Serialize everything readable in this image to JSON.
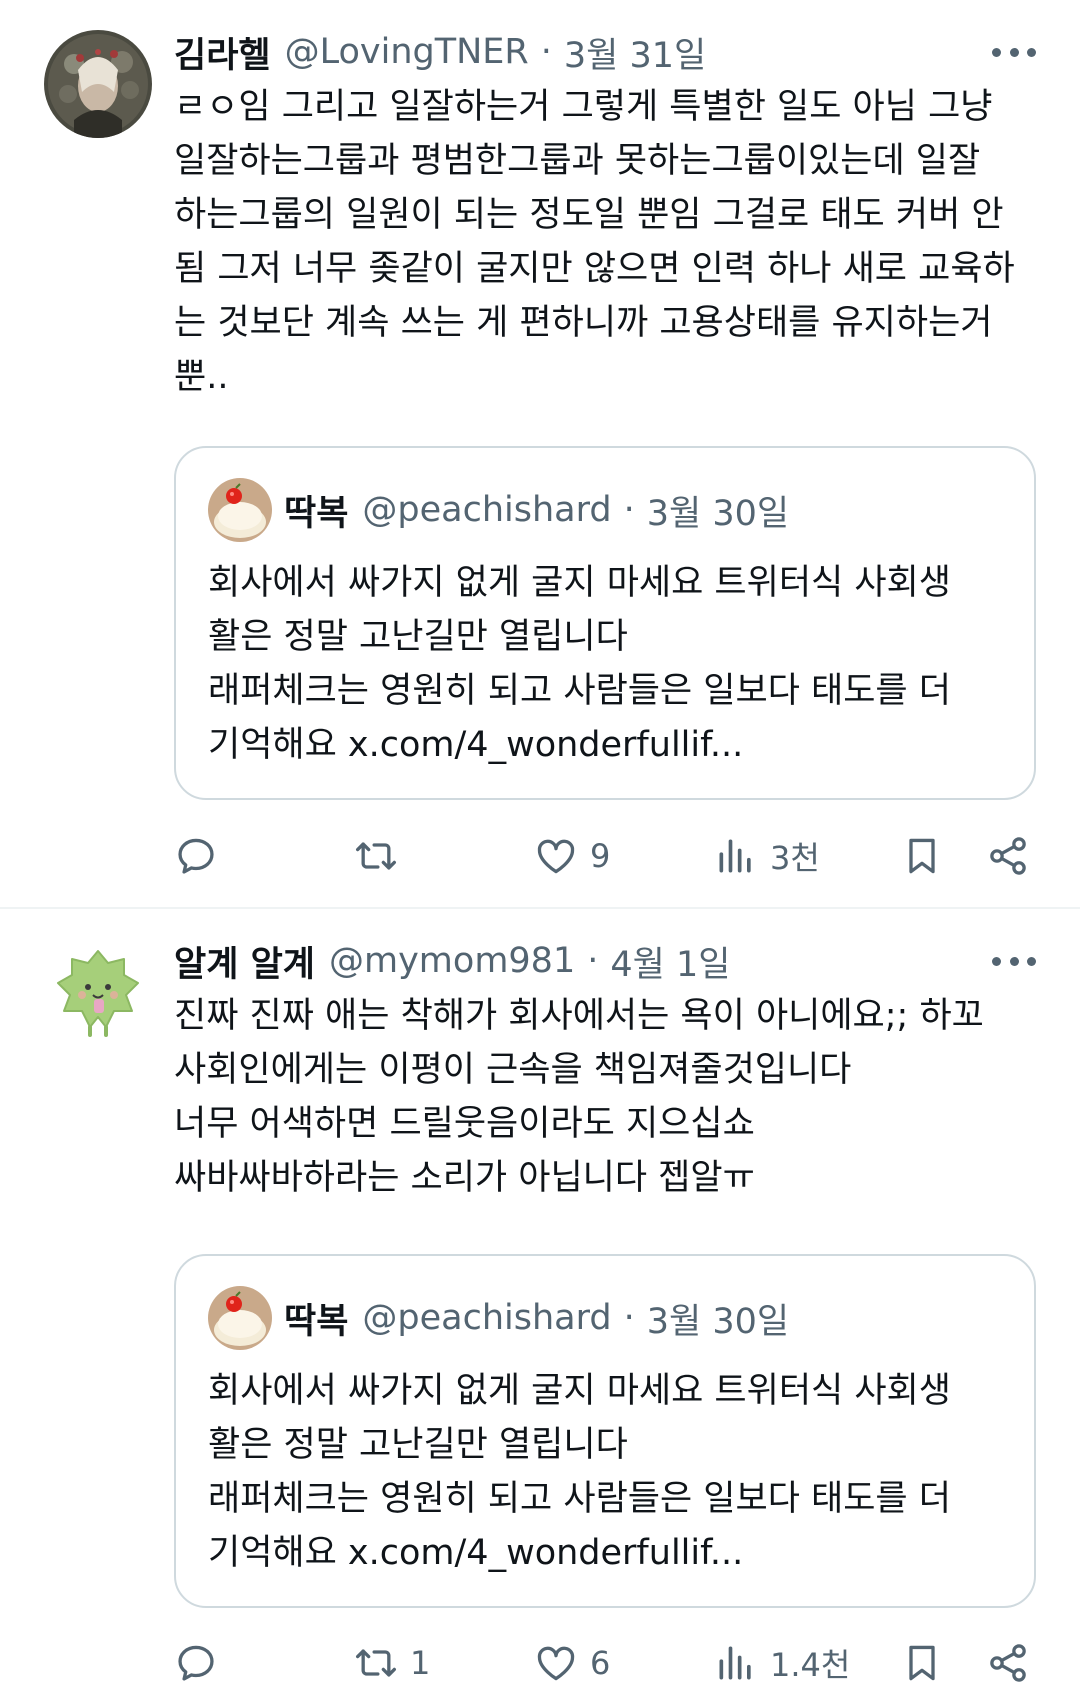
{
  "tweets": [
    {
      "name": "김라헬",
      "handle": "@LovingTNER",
      "date": "3월 31일",
      "lines": [
        "ㄹㅇ임 그리고 일잘하는거 그렇게 특별한 일도 아님 그냥",
        "일잘하는그룹과 평범한그룹과 못하는그룹이있는데 일잘",
        "하는그룹의 일원이 되는 정도일 뿐임 그걸로 태도 커버 안",
        "됨 그저 너무 좆같이 굴지만 않으면 인력 하나 새로 교육하",
        "는 것보단 계속 쓰는 게 편하니까 고용상태를 유지하는거",
        "뿐.."
      ],
      "quote": {
        "name": "딱복",
        "handle": "@peachishard",
        "date": "3월 30일",
        "lines": [
          "회사에서 싸가지 없게 굴지 마세요 트위터식 사회생",
          "활은 정말 고난길만 열립니다",
          "래퍼체크는 영원히 되고 사람들은 일보다 태도를 더",
          "기억해요 x.com/4_wonderfullif..."
        ]
      },
      "stats": {
        "replies": "",
        "retweets": "",
        "likes": "9",
        "views": "3천"
      }
    },
    {
      "name": "알계 알계",
      "handle": "@mymom981",
      "date": "4월 1일",
      "lines": [
        "진짜 진짜 애는 착해가 회사에서는 욕이 아니에요;; 하꼬",
        "사회인에게는 이평이 근속을 책임져줄것입니다",
        "너무 어색하면 드릴웃음이라도 지으십쇼",
        "싸바싸바하라는 소리가 아닙니다 젭알ㅠ"
      ],
      "quote": {
        "name": "딱복",
        "handle": "@peachishard",
        "date": "3월 30일",
        "lines": [
          "회사에서 싸가지 없게 굴지 마세요 트위터식 사회생",
          "활은 정말 고난길만 열립니다",
          "래퍼체크는 영원히 되고 사람들은 일보다 태도를 더",
          "기억해요 x.com/4_wonderfullif..."
        ]
      },
      "stats": {
        "replies": "",
        "retweets": "1",
        "likes": "6",
        "views": "1.4천"
      }
    }
  ],
  "colors": {
    "text": "#0f1419",
    "secondary": "#536471",
    "border": "#cfd9de"
  },
  "icons": [
    "reply-icon",
    "retweet-icon",
    "like-icon",
    "views-icon",
    "bookmark-icon",
    "share-icon",
    "more-icon"
  ]
}
